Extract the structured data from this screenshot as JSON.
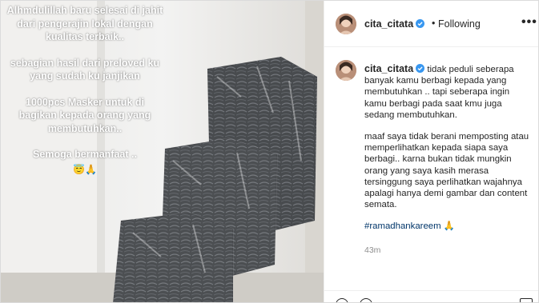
{
  "photo": {
    "overlay_lines": [
      "Alhmdulillah baru selesai di jahit dari pengerajin lokal dengan kualitas terbaik..",
      "sebagian hasil dari preloved ku yang sudah ku janjikan",
      "1000pcs Masker untuk di bagikan kepada orang yang membutuhkan..",
      "Semoga bermanfaat .."
    ],
    "overlay_emoji": "😇🙏"
  },
  "header": {
    "username": "cita_citata",
    "separator": "•",
    "follow_status": "Following",
    "more_label": "•••"
  },
  "caption": {
    "username": "cita_citata",
    "first_text": "tidak peduli seberapa banyak kamu berbagi kepada yang membutuhkan .. tapi seberapa ingin kamu berbagi pada saat kmu juga sedang membutuhkan.",
    "second_text": "maaf saya tidak berani memposting atau memperlihatkan kepada siapa saya berbagi.. karna bukan tidak mungkin orang yang saya kasih merasa tersinggung saya perlihatkan wajahnya apalagi hanya demi gambar dan content semata.",
    "hashtag": "#ramadhankareem",
    "hashtag_emoji": "🙏"
  },
  "timestamp": "43m",
  "colors": {
    "verified": "#3897f0",
    "link": "#003569",
    "muted": "#8e8e8e",
    "text": "#262626"
  }
}
